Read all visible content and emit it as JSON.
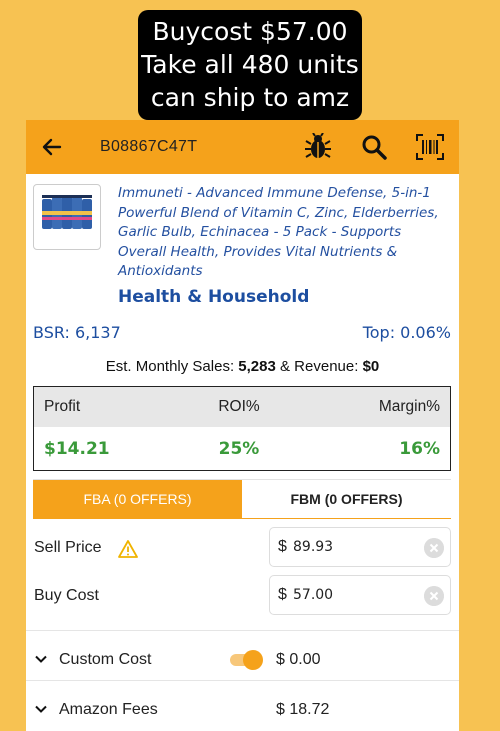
{
  "caption": {
    "line1": "Buycost $57.00",
    "line2": "Take all 480 units",
    "line3": "can ship to amz"
  },
  "toolbar": {
    "asin": "B08867C47T",
    "back_icon": "arrow-left-icon",
    "bug_icon": "bug-icon",
    "search_icon": "search-icon",
    "scan_icon": "barcode-scan-icon"
  },
  "product": {
    "title": "Immuneti - Advanced Immune Defense, 5-in-1 Powerful Blend of Vitamin C, Zinc, Elderberries, Garlic Bulb, Echinacea - 5 Pack - Supports Overall Health, Provides Vital Nutrients & Antioxidants",
    "category": "Health & Household"
  },
  "rank": {
    "bsr": "BSR: 6,137",
    "top": "Top: 0.06%"
  },
  "sales": {
    "prefix": "Est. Monthly Sales: ",
    "monthly": "5,283",
    "middle": " & Revenue: ",
    "revenue": "$0"
  },
  "stats": {
    "headers": [
      "Profit",
      "ROI%",
      "Margin%"
    ],
    "profit": "$14.21",
    "roi": "25%",
    "margin": "16%"
  },
  "tabs": {
    "fba": "FBA (0 OFFERS)",
    "fbm": "FBM (0 OFFERS)"
  },
  "form": {
    "sell_price_label": "Sell Price",
    "sell_price_currency": "$",
    "sell_price_value": "89.93",
    "buy_cost_label": "Buy Cost",
    "buy_cost_currency": "$",
    "buy_cost_value": "57.00",
    "custom_cost_label": "Custom Cost",
    "custom_cost_value": "$ 0.00",
    "amazon_fees_label": "Amazon Fees",
    "amazon_fees_value": "$ 18.72"
  },
  "colors": {
    "background": "#f7c252",
    "toolbar": "#f5a21b",
    "link_blue": "#1d4ea0",
    "profit_green": "#3a9a3a",
    "warning": "#f0b400"
  }
}
